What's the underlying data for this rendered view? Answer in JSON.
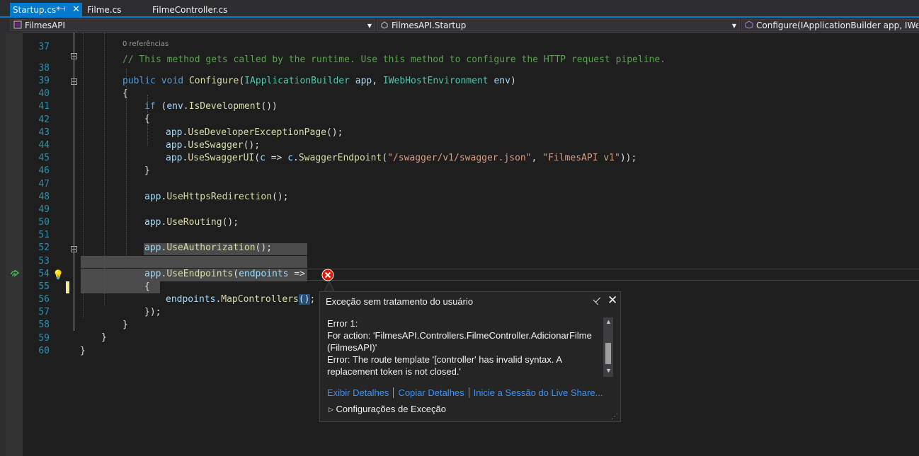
{
  "tabs": [
    {
      "label": "Startup.cs*",
      "active": true
    },
    {
      "label": "Filme.cs",
      "active": false
    },
    {
      "label": "FilmeController.cs",
      "active": false
    }
  ],
  "nav": {
    "project": "FilmesAPI",
    "class": "FilmesAPI.Startup",
    "member": "Configure(IApplicationBuilder app, IWebHo"
  },
  "code": {
    "references": "0 referências",
    "line_numbers": [
      "37",
      "38",
      "39",
      "40",
      "41",
      "42",
      "43",
      "44",
      "45",
      "46",
      "47",
      "48",
      "49",
      "50",
      "51",
      "52",
      "53",
      "54",
      "55",
      "56",
      "57",
      "58",
      "59",
      "60"
    ],
    "lines": [
      "// This method gets called by the runtime. Use this method to configure the HTTP request pipeline.",
      "public void Configure(IApplicationBuilder app, IWebHostEnvironment env)",
      "{",
      "if (env.IsDevelopment())",
      "{",
      "app.UseDeveloperExceptionPage();",
      "app.UseSwagger();",
      "app.UseSwaggerUI(c => c.SwaggerEndpoint(\"/swagger/v1/swagger.json\", \"FilmesAPI v1\"));",
      "}",
      "",
      "app.UseHttpsRedirection();",
      "",
      "app.UseRouting();",
      "",
      "app.UseAuthorization();",
      "",
      "app.UseEndpoints(endpoints =>",
      "{",
      "endpoints.MapControllers();",
      "});",
      "}",
      "}",
      "}",
      ""
    ]
  },
  "exception": {
    "title": "Exceção sem tratamento do usuário",
    "message_lines": [
      "Error 1:",
      "For action: 'FilmesAPI.Controllers.FilmeController.AdicionarFilme",
      "(FilmesAPI)'",
      "Error: The route template '[controller' has invalid syntax. A",
      "replacement token is not closed.'"
    ],
    "links": [
      "Exibir Detalhes",
      "Copiar Detalhes",
      "Inicie a Sessão do Live Share..."
    ],
    "settings_label": "Configurações de Exceção"
  },
  "colors": {
    "accent": "#007acc",
    "editor_background": "#1e1e1e",
    "error_icon": "#e51400",
    "link": "#3794ff"
  }
}
